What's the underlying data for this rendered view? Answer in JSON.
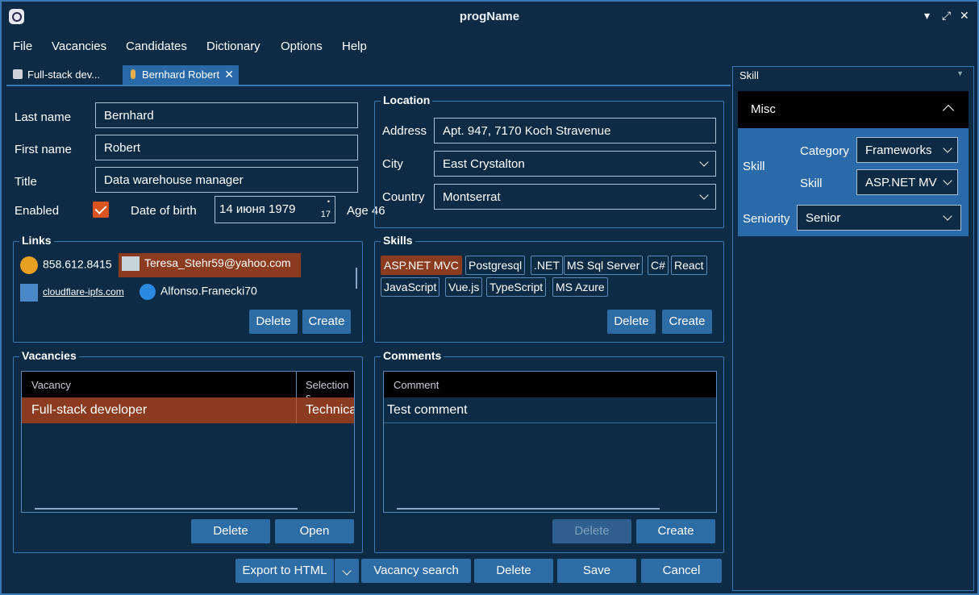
{
  "window": {
    "title": "progName"
  },
  "menu": [
    "File",
    "Vacancies",
    "Candidates",
    "Dictionary",
    "Options",
    "Help"
  ],
  "tabs": [
    {
      "label": "Full-stack dev..."
    },
    {
      "label": "Bernhard Robert"
    }
  ],
  "person": {
    "last_name_label": "Last name",
    "last_name": "Bernhard",
    "first_name_label": "First name",
    "first_name": "Robert",
    "title_label": "Title",
    "title": "Data warehouse manager",
    "enabled_label": "Enabled",
    "dob_label": "Date of birth",
    "dob": "14 июня 1979",
    "dob_spin": "17",
    "age_text": "Age 46"
  },
  "location": {
    "title": "Location",
    "address_label": "Address",
    "address": "Apt. 947, 7170 Koch Stravenue",
    "city_label": "City",
    "city": "East Crystalton",
    "country_label": "Country",
    "country": "Montserrat"
  },
  "links": {
    "title": "Links",
    "items": [
      "858.612.8415",
      "Teresa_Stehr59@yahoo.com",
      "cloudflare-ipfs.com",
      "Alfonso.Franecki70"
    ],
    "delete": "Delete",
    "create": "Create"
  },
  "skills": {
    "title": "Skills",
    "tags": [
      "ASP.NET MVC",
      "Postgresql",
      ".NET",
      "MS Sql Server",
      "C#",
      "React",
      "JavaScript",
      "Vue.js",
      "TypeScript",
      "MS Azure"
    ],
    "delete": "Delete",
    "create": "Create"
  },
  "vacancies": {
    "title": "Vacancies",
    "columns": [
      "Vacancy",
      "Selection s"
    ],
    "rows": [
      [
        "Full-stack developer",
        "Technica"
      ]
    ],
    "delete": "Delete",
    "open": "Open"
  },
  "comments": {
    "title": "Comments",
    "columns": [
      "Comment"
    ],
    "rows": [
      "Test comment"
    ],
    "delete": "Delete",
    "create": "Create"
  },
  "footer": {
    "export": "Export to HTML",
    "vacancy_search": "Vacancy search",
    "delete": "Delete",
    "save": "Save",
    "cancel": "Cancel"
  },
  "side": {
    "header": "Skill",
    "misc": "Misc",
    "skill_label": "Skill",
    "category_label": "Category",
    "category": "Frameworks",
    "skill_field_label": "Skill",
    "skill": "ASP.NET MV",
    "seniority_label": "Seniority",
    "seniority": "Senior"
  },
  "colors": {
    "accent": "#2e6ca6",
    "selection": "#8b3c20",
    "background": "#0d2b45",
    "check": "#d9541f"
  }
}
